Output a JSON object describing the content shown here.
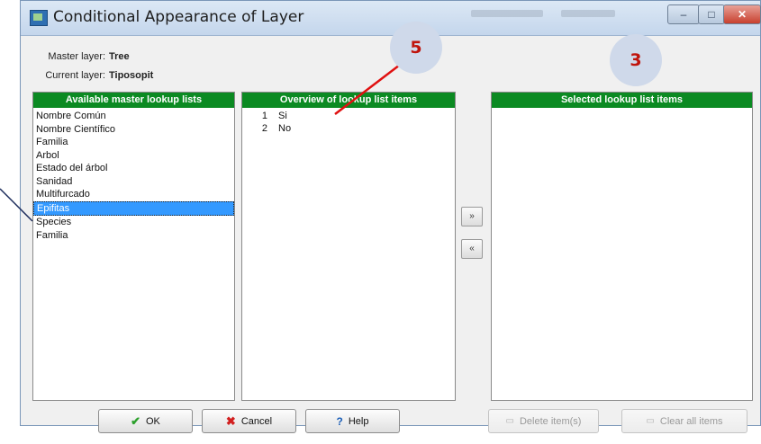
{
  "window": {
    "title": "Conditional Appearance of Layer"
  },
  "header": {
    "master_label": "Master layer:",
    "master_value": "Tree",
    "current_label": "Current layer:",
    "current_value": "Tiposopit"
  },
  "available": {
    "title": "Available master lookup lists",
    "items": [
      "Nombre Común",
      "Nombre Científico",
      "Familia",
      "Arbol",
      "Estado del árbol",
      "Sanidad",
      "Multifurcado",
      "Epifitas",
      "Species",
      "Familia"
    ],
    "selected_index": 7
  },
  "overview": {
    "title": "Overview of lookup list items",
    "items": [
      {
        "num": "1",
        "value": "Si"
      },
      {
        "num": "2",
        "value": "No"
      }
    ]
  },
  "selected": {
    "title": "Selected lookup list items"
  },
  "move_buttons": {
    "add": "»",
    "remove": "«"
  },
  "buttons": {
    "ok": "OK",
    "cancel": "Cancel",
    "help": "Help",
    "delete": "Delete item(s)",
    "clear": "Clear all items"
  },
  "annotations": {
    "badge_left": "5",
    "badge_right": "3",
    "color": "#c0140c"
  }
}
